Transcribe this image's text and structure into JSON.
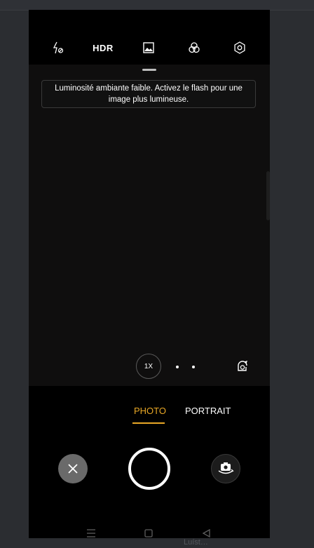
{
  "camera_bar": {
    "flash_icon": "flash-off-icon",
    "hdr_label": "HDR",
    "filter_icon": "image-icon",
    "color_icon": "color-filter-icon",
    "settings_icon": "settings-icon"
  },
  "viewfinder": {
    "notice": "Luminosité ambiante faible. Activez le flash pour une image plus lumineuse.",
    "zoom_label": "1X",
    "lens_icon": "lens-switch-icon"
  },
  "modes": {
    "items": [
      {
        "label": "PHOTO",
        "active": true
      },
      {
        "label": "PORTRAIT",
        "active": false
      }
    ]
  },
  "controls": {
    "close_icon": "close-icon",
    "shutter": "shutter-button",
    "switch_icon": "camera-switch-icon"
  },
  "nav": {
    "menu_icon": "menu-icon",
    "home_icon": "home-icon",
    "back_icon": "back-icon"
  },
  "background_text": {
    "bottom": "…",
    "bottom_right": "Luíst…"
  },
  "colors": {
    "accent": "#e9a826",
    "background": "#000000",
    "viewfinder": "#0f0e0e",
    "outer": "#2b2d31"
  }
}
